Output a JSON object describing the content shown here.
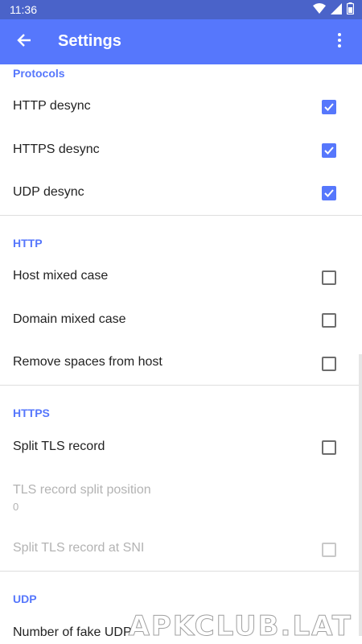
{
  "status_bar": {
    "time": "11:36",
    "icons": [
      "wifi-icon",
      "signal-icon",
      "battery-icon"
    ]
  },
  "app_bar": {
    "title": "Settings",
    "back_icon": "back-arrow-icon",
    "menu_icon": "overflow-menu-icon"
  },
  "colors": {
    "accent": "#5677fc",
    "status_bar": "#4a63c9",
    "disabled_text": "#b3b3b3"
  },
  "sections": [
    {
      "title": "Protocols",
      "items": [
        {
          "label": "HTTP desync",
          "checked": true,
          "enabled": true
        },
        {
          "label": "HTTPS desync",
          "checked": true,
          "enabled": true
        },
        {
          "label": "UDP desync",
          "checked": true,
          "enabled": true
        }
      ]
    },
    {
      "title": "HTTP",
      "items": [
        {
          "label": "Host mixed case",
          "checked": false,
          "enabled": true
        },
        {
          "label": "Domain mixed case",
          "checked": false,
          "enabled": true
        },
        {
          "label": "Remove spaces from host",
          "checked": false,
          "enabled": true
        }
      ]
    },
    {
      "title": "HTTPS",
      "items": [
        {
          "label": "Split TLS record",
          "checked": false,
          "enabled": true
        },
        {
          "label": "TLS record split position",
          "summary": "0",
          "enabled": false
        },
        {
          "label": "Split TLS record at SNI",
          "checked": false,
          "enabled": false
        }
      ]
    },
    {
      "title": "UDP",
      "items": [
        {
          "label": "Number of fake UDP"
        }
      ]
    }
  ],
  "watermark": "APKCLUB.LAT"
}
